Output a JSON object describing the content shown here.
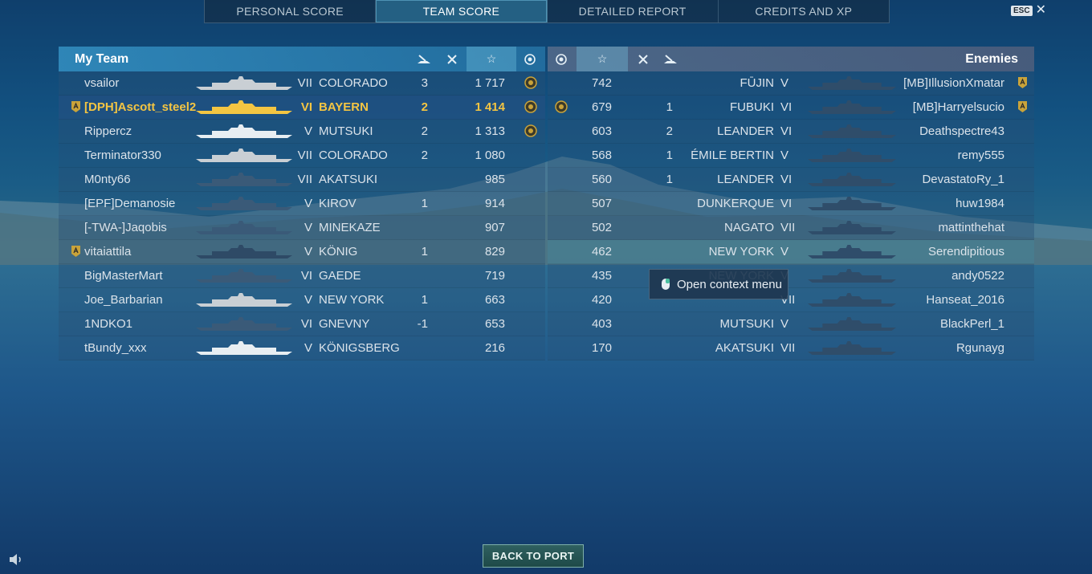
{
  "tabs": [
    {
      "label": "PERSONAL SCORE",
      "active": false
    },
    {
      "label": "TEAM SCORE",
      "active": true
    },
    {
      "label": "DETAILED REPORT",
      "active": false
    },
    {
      "label": "CREDITS AND XP",
      "active": false
    }
  ],
  "close": {
    "key_label": "ESC",
    "icon": "close-icon"
  },
  "my_team": {
    "title": "My Team",
    "columns": [
      "ships-destroyed-icon",
      "planes-destroyed-icon",
      "star-icon",
      "achievement-icon"
    ],
    "players": [
      {
        "name": "vsailor",
        "tier": "VII",
        "ship": "COLORADO",
        "kills": "3",
        "xp": "1 717",
        "award": true,
        "badge": false,
        "me": false,
        "ship_color": "#c9cfd4"
      },
      {
        "name": "[DPH]Ascott_steel2",
        "tier": "VI",
        "ship": "BAYERN",
        "kills": "2",
        "xp": "1 414",
        "award": true,
        "badge": true,
        "me": true,
        "ship_color": "#f4c542"
      },
      {
        "name": "Rippercz",
        "tier": "V",
        "ship": "MUTSUKI",
        "kills": "2",
        "xp": "1 313",
        "award": true,
        "badge": false,
        "me": false,
        "ship_color": "#e8eef2"
      },
      {
        "name": "Terminator330",
        "tier": "VII",
        "ship": "COLORADO",
        "kills": "2",
        "xp": "1 080",
        "award": false,
        "badge": false,
        "me": false,
        "ship_color": "#c9cfd4"
      },
      {
        "name": "M0nty66",
        "tier": "VII",
        "ship": "AKATSUKI",
        "kills": "",
        "xp": "985",
        "award": false,
        "badge": false,
        "me": false,
        "ship_color": "#3a5a78"
      },
      {
        "name": "[EPF]Demanosie",
        "tier": "V",
        "ship": "KIROV",
        "kills": "1",
        "xp": "914",
        "award": false,
        "badge": false,
        "me": false,
        "ship_color": "#3a5a78"
      },
      {
        "name": "[-TWA-]Jaqobis",
        "tier": "V",
        "ship": "MINEKAZE",
        "kills": "",
        "xp": "907",
        "award": false,
        "badge": false,
        "me": false,
        "ship_color": "#3a5a78"
      },
      {
        "name": "vitaiattila",
        "tier": "V",
        "ship": "KÖNIG",
        "kills": "1",
        "xp": "829",
        "award": false,
        "badge": true,
        "me": false,
        "ship_color": "#2e4a66"
      },
      {
        "name": "BigMasterMart",
        "tier": "VI",
        "ship": "GAEDE",
        "kills": "",
        "xp": "719",
        "award": false,
        "badge": false,
        "me": false,
        "ship_color": "#3a5a78"
      },
      {
        "name": "Joe_Barbarian",
        "tier": "V",
        "ship": "NEW YORK",
        "kills": "1",
        "xp": "663",
        "award": false,
        "badge": false,
        "me": false,
        "ship_color": "#c9cfd4"
      },
      {
        "name": "1NDKO1",
        "tier": "VI",
        "ship": "GNEVNY",
        "kills": "-1",
        "xp": "653",
        "award": false,
        "badge": false,
        "me": false,
        "ship_color": "#3a5a78"
      },
      {
        "name": "tBundy_xxx",
        "tier": "V",
        "ship": "KÖNIGSBERG",
        "kills": "",
        "xp": "216",
        "award": false,
        "badge": false,
        "me": false,
        "ship_color": "#e8eef2"
      }
    ]
  },
  "enemies": {
    "title": "Enemies",
    "columns": [
      "achievement-icon",
      "star-icon",
      "planes-destroyed-icon",
      "ships-destroyed-icon"
    ],
    "players": [
      {
        "name": "[MB]IllusionXmatar",
        "tier": "V",
        "ship": "FŪJIN",
        "kills": "",
        "xp": "742",
        "award": false,
        "badge": true,
        "hl": false
      },
      {
        "name": "[MB]Harryelsucio",
        "tier": "VI",
        "ship": "FUBUKI",
        "kills": "1",
        "xp": "679",
        "award": true,
        "badge": true,
        "hl": false
      },
      {
        "name": "Deathspectre43",
        "tier": "VI",
        "ship": "LEANDER",
        "kills": "2",
        "xp": "603",
        "award": false,
        "badge": false,
        "hl": false
      },
      {
        "name": "remy555",
        "tier": "V",
        "ship": "ÉMILE BERTIN",
        "kills": "1",
        "xp": "568",
        "award": false,
        "badge": false,
        "hl": false
      },
      {
        "name": "DevastatoRy_1",
        "tier": "VI",
        "ship": "LEANDER",
        "kills": "1",
        "xp": "560",
        "award": false,
        "badge": false,
        "hl": false
      },
      {
        "name": "huw1984",
        "tier": "VI",
        "ship": "DUNKERQUE",
        "kills": "",
        "xp": "507",
        "award": false,
        "badge": false,
        "hl": false
      },
      {
        "name": "mattinthehat",
        "tier": "VII",
        "ship": "NAGATO",
        "kills": "",
        "xp": "502",
        "award": false,
        "badge": false,
        "hl": false
      },
      {
        "name": "Serendipitious",
        "tier": "V",
        "ship": "NEW YORK",
        "kills": "",
        "xp": "462",
        "award": false,
        "badge": false,
        "hl": true
      },
      {
        "name": "andy0522",
        "tier": "V",
        "ship": "NEW YORK",
        "kills": "",
        "xp": "435",
        "award": false,
        "badge": false,
        "hl": false
      },
      {
        "name": "Hanseat_2016",
        "tier": "VII",
        "ship": "",
        "kills": "",
        "xp": "420",
        "award": false,
        "badge": false,
        "hl": false
      },
      {
        "name": "BlackPerl_1",
        "tier": "V",
        "ship": "MUTSUKI",
        "kills": "",
        "xp": "403",
        "award": false,
        "badge": false,
        "hl": false
      },
      {
        "name": "Rgunayg",
        "tier": "VII",
        "ship": "AKATSUKI",
        "kills": "",
        "xp": "170",
        "award": false,
        "badge": false,
        "hl": false
      }
    ]
  },
  "context_menu": {
    "label": "Open context menu",
    "icon": "mouse-icon"
  },
  "back_button": {
    "label": "BACK TO PORT"
  },
  "sound": {
    "icon": "speaker-icon"
  },
  "colors": {
    "accent_blue": "#3c96be",
    "highlight_gold": "#f4c542",
    "enemy_ship": "#2f4d6a"
  }
}
